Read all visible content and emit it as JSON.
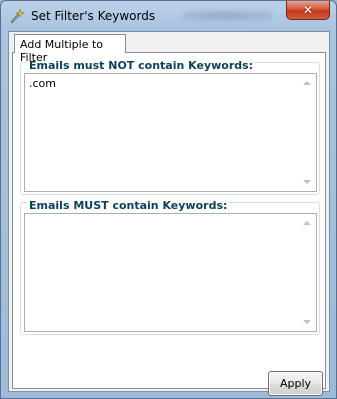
{
  "window": {
    "title": "Set Filter's Keywords",
    "close_glyph": "✕",
    "icon": "magic-wand-icon"
  },
  "tabs": [
    {
      "label": "Add Multiple to Filter",
      "selected": true
    }
  ],
  "groups": {
    "exclude": {
      "legend": "Emails must NOT contain Keywords:",
      "value": ".com"
    },
    "include": {
      "legend": "Emails MUST contain Keywords:",
      "value": ""
    }
  },
  "buttons": {
    "apply_label": "Apply"
  },
  "colors": {
    "legend_text": "#0c3f5a",
    "close_button": "#c23a1f"
  }
}
